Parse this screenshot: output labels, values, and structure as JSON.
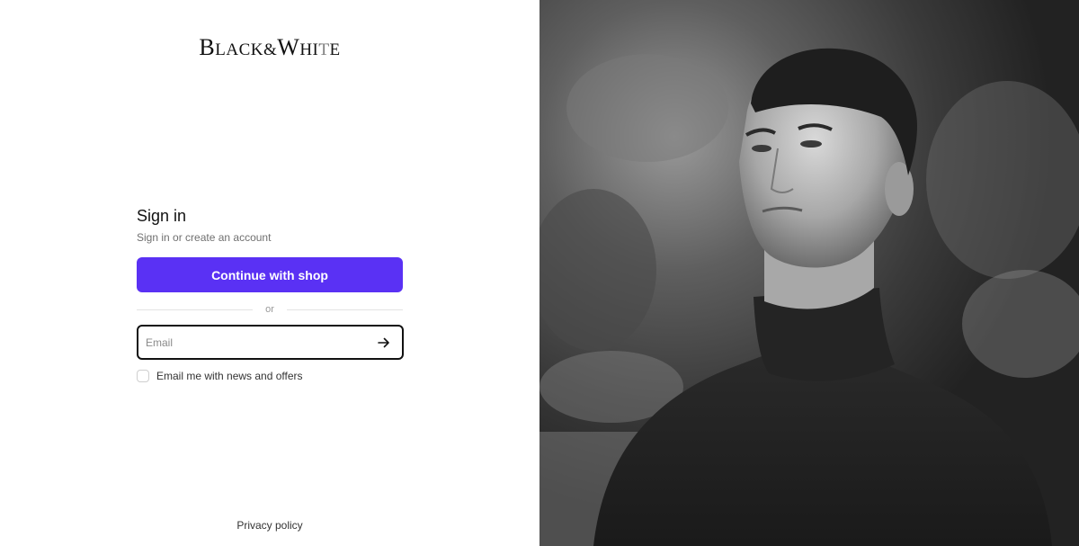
{
  "brand": {
    "logo_b": "B",
    "logo_lack": "LACK",
    "logo_amp": "&",
    "logo_w": "W",
    "logo_hite": "HITE"
  },
  "signin": {
    "title": "Sign in",
    "subtitle": "Sign in or create an account",
    "shop_button": "Continue with shop",
    "divider": "or",
    "email_placeholder": "Email",
    "email_value": "",
    "newsletter_label": "Email me with news and offers",
    "newsletter_checked": false
  },
  "footer": {
    "privacy": "Privacy policy"
  },
  "colors": {
    "accent": "#5a31f4"
  },
  "icons": {
    "submit": "arrow-right-icon"
  }
}
